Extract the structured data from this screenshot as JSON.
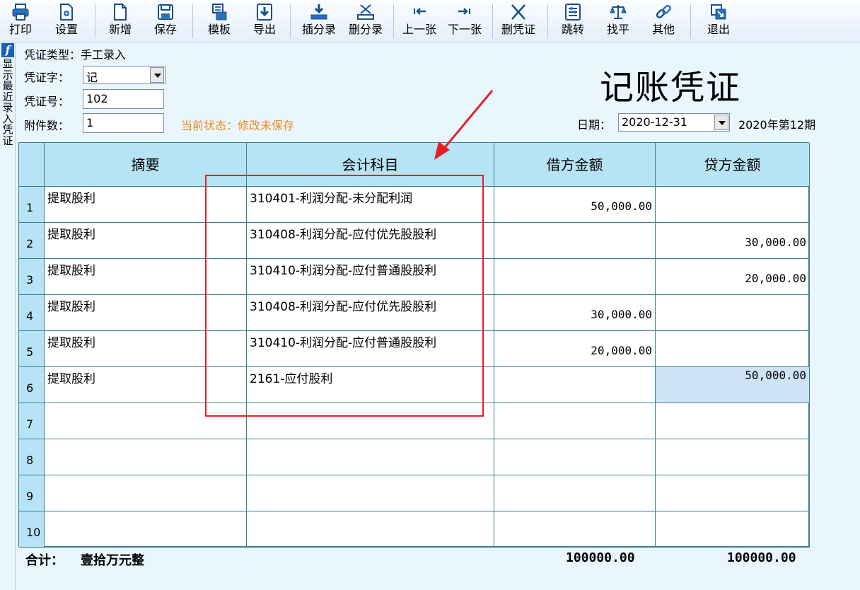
{
  "toolbar": {
    "items": [
      {
        "label": "打印",
        "icon": "printer-icon"
      },
      {
        "label": "设置",
        "icon": "settings-icon"
      },
      {
        "label": "新增",
        "icon": "new-file-icon"
      },
      {
        "label": "保存",
        "icon": "save-icon"
      },
      {
        "label": "模板",
        "icon": "template-icon"
      },
      {
        "label": "导出",
        "icon": "export-icon"
      },
      {
        "label": "插分录",
        "icon": "insert-entry-icon"
      },
      {
        "label": "删分录",
        "icon": "delete-entry-icon"
      },
      {
        "label": "上一张",
        "icon": "previous-icon"
      },
      {
        "label": "下一张",
        "icon": "next-icon"
      },
      {
        "label": "删凭证",
        "icon": "delete-voucher-icon"
      },
      {
        "label": "跳转",
        "icon": "jump-icon"
      },
      {
        "label": "找平",
        "icon": "balance-icon"
      },
      {
        "label": "其他",
        "icon": "link-icon"
      },
      {
        "label": "退出",
        "icon": "exit-icon"
      }
    ]
  },
  "side": {
    "badge": "f",
    "text": "显示最近录入凭证"
  },
  "form": {
    "type_label": "凭证类型：",
    "type_value": "手工录入",
    "word_label": "凭证字：",
    "word_value": "记",
    "number_label": "凭证号：",
    "number_value": "102",
    "attach_label": "附件数：",
    "attach_value": "1",
    "status_text": "当前状态：修改未保存",
    "title": "记账凭证",
    "date_label": "日期：",
    "date_value": "2020-12-31",
    "period": "2020年第12期"
  },
  "table": {
    "headers": [
      "摘要",
      "会计科目",
      "借方金额",
      "贷方金额"
    ],
    "rows": [
      {
        "no": "1",
        "summary": "提取股利",
        "account": "310401-利润分配-未分配利润",
        "debit": "50,000.00",
        "credit": ""
      },
      {
        "no": "2",
        "summary": "提取股利",
        "account": "310408-利润分配-应付优先股股利",
        "debit": "",
        "credit": "30,000.00"
      },
      {
        "no": "3",
        "summary": "提取股利",
        "account": "310410-利润分配-应付普通股股利",
        "debit": "",
        "credit": "20,000.00"
      },
      {
        "no": "4",
        "summary": "提取股利",
        "account": "310408-利润分配-应付优先股股利",
        "debit": "30,000.00",
        "credit": ""
      },
      {
        "no": "5",
        "summary": "提取股利",
        "account": "310410-利润分配-应付普通股股利",
        "debit": "20,000.00",
        "credit": ""
      },
      {
        "no": "6",
        "summary": "提取股利",
        "account": "2161-应付股利",
        "debit": "",
        "credit": "50,000.00"
      },
      {
        "no": "7",
        "summary": "",
        "account": "",
        "debit": "",
        "credit": ""
      },
      {
        "no": "8",
        "summary": "",
        "account": "",
        "debit": "",
        "credit": ""
      },
      {
        "no": "9",
        "summary": "",
        "account": "",
        "debit": "",
        "credit": ""
      },
      {
        "no": "10",
        "summary": "",
        "account": "",
        "debit": "",
        "credit": ""
      }
    ]
  },
  "totals": {
    "label": "合计：",
    "words": "壹拾万元整",
    "debit_total": "100000.00",
    "credit_total": "100000.00"
  },
  "colors": {
    "status": "#f08a1c",
    "annotation": "#e81e25",
    "header_bg": "#b7e4f5"
  }
}
